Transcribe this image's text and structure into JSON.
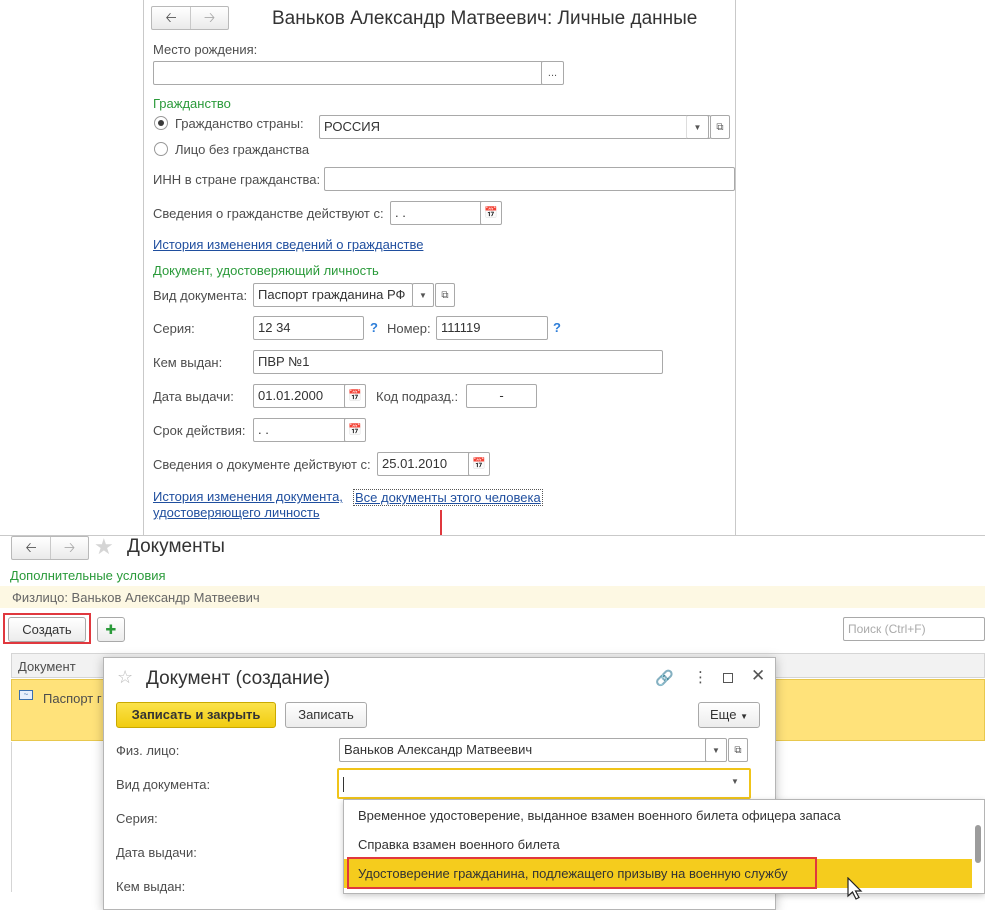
{
  "top_form": {
    "title": "Ваньков Александр Матвеевич: Личные данные",
    "birthplace_label": "Место рождения:",
    "birthplace_value": "",
    "citizenship_section": "Гражданство",
    "citizenship_country_label": "Гражданство страны:",
    "citizenship_country_value": "РОССИЯ",
    "stateless_label": "Лицо без гражданства",
    "inn_label": "ИНН в стране гражданства:",
    "inn_value": "",
    "citizenship_effective_label": "Сведения о гражданстве действуют с:",
    "citizenship_effective_value": " .  .",
    "citizenship_history_link": "История изменения сведений о гражданстве",
    "id_doc_section": "Документ, удостоверяющий личность",
    "doc_type_label": "Вид документа:",
    "doc_type_value": "Паспорт гражданина РФ",
    "series_label": "Серия:",
    "series_value": "12 34",
    "number_label": "Номер:",
    "number_value": "111119",
    "issued_by_label": "Кем выдан:",
    "issued_by_value": "ПВР №1",
    "issue_date_label": "Дата выдачи:",
    "issue_date_value": "01.01.2000",
    "dept_code_label": "Код подразд.:",
    "dept_code_value": "-",
    "valid_until_label": "Срок действия:",
    "valid_until_value": " .  .",
    "doc_effective_label": "Сведения о документе действуют с:",
    "doc_effective_value": "25.01.2010",
    "doc_history_link_line1": "История изменения документа,",
    "doc_history_link_line2": "удостоверяющего личность",
    "all_docs_link": "Все документы этого человека"
  },
  "documents_window": {
    "title": "Документы",
    "additional_conditions": "Дополнительные условия",
    "filter_text": "Физлицо: Ваньков Александр Матвеевич",
    "create_button": "Создать",
    "search_placeholder": "Поиск (Ctrl+F)",
    "column_document": "Документ",
    "row_text": "Паспорт г"
  },
  "create_dialog": {
    "title": "Документ (создание)",
    "save_close_button": "Записать и закрыть",
    "save_button": "Записать",
    "more_button": "Еще",
    "person_label": "Физ. лицо:",
    "person_value": "Ваньков Александр Матвеевич",
    "doc_type_label": "Вид документа:",
    "doc_type_value": "",
    "series_label": "Серия:",
    "issue_date_label": "Дата выдачи:",
    "issued_by_label": "Кем выдан:"
  },
  "dropdown": {
    "items": [
      "Временное удостоверение, выданное взамен военного билета офицера запаса",
      "Справка взамен военного билета",
      "Удостоверение гражданина, подлежащего призыву на военную службу"
    ],
    "selected_index": 2
  },
  "icons": {
    "nav_back": "arrow-left-icon",
    "nav_forward": "arrow-right-icon",
    "calendar": "calendar-icon",
    "dropdown": "chevron-down-icon",
    "open": "open-form-icon",
    "star": "star-icon",
    "link": "link-icon",
    "more": "kebab-icon",
    "maximize": "maximize-icon",
    "close": "close-icon",
    "mouse": "mouse-pointer-icon"
  },
  "colors": {
    "section_green": "#2a9a3a",
    "link_blue": "#1f4e9e",
    "selection_yellow": "#ffe27a",
    "highlight_red": "#e0383e",
    "primary_button_yellow": "#f6d523"
  }
}
